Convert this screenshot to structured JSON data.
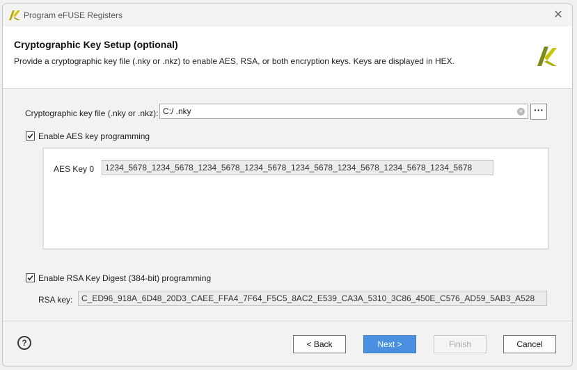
{
  "window": {
    "title": "Program eFUSE Registers",
    "close_symbol": "✕"
  },
  "header": {
    "title": "Cryptographic Key Setup (optional)",
    "description": "Provide a cryptographic key file (.nky or .nkz) to enable AES, RSA, or both encryption keys. Keys are displayed in HEX."
  },
  "key_file": {
    "label": "Cryptographic key file (.nky or .nkz):",
    "value": "C:/                                                           .nky",
    "browse_label": "···",
    "clear_symbol": "×"
  },
  "aes": {
    "checkbox_label": "Enable AES key programming",
    "checked": true,
    "key_label": "AES Key 0",
    "key_value": "1234_5678_1234_5678_1234_5678_1234_5678_1234_5678_1234_5678_1234_5678_1234_5678"
  },
  "rsa": {
    "checkbox_label": "Enable RSA Key Digest (384-bit) programming",
    "checked": true,
    "key_label": "RSA key:",
    "key_value": "C_ED96_918A_6D48_20D3_CAEE_FFA4_7F64_F5C5_8AC2_E539_CA3A_5310_3C86_450E_C576_AD59_5AB3_A528"
  },
  "footer": {
    "help_label": "?",
    "back_label": "< Back",
    "next_label": "Next >",
    "finish_label": "Finish",
    "cancel_label": "Cancel"
  },
  "colors": {
    "accent": "#4a8fe0",
    "logo_yellow": "#c8b400"
  },
  "icons": {
    "title_logo": "xilinx-logo-icon",
    "header_logo": "xilinx-logo-icon",
    "help": "help-icon",
    "close": "close-icon",
    "clear": "clear-icon",
    "browse": "ellipsis-icon",
    "checkbox": "checkmark-icon"
  }
}
